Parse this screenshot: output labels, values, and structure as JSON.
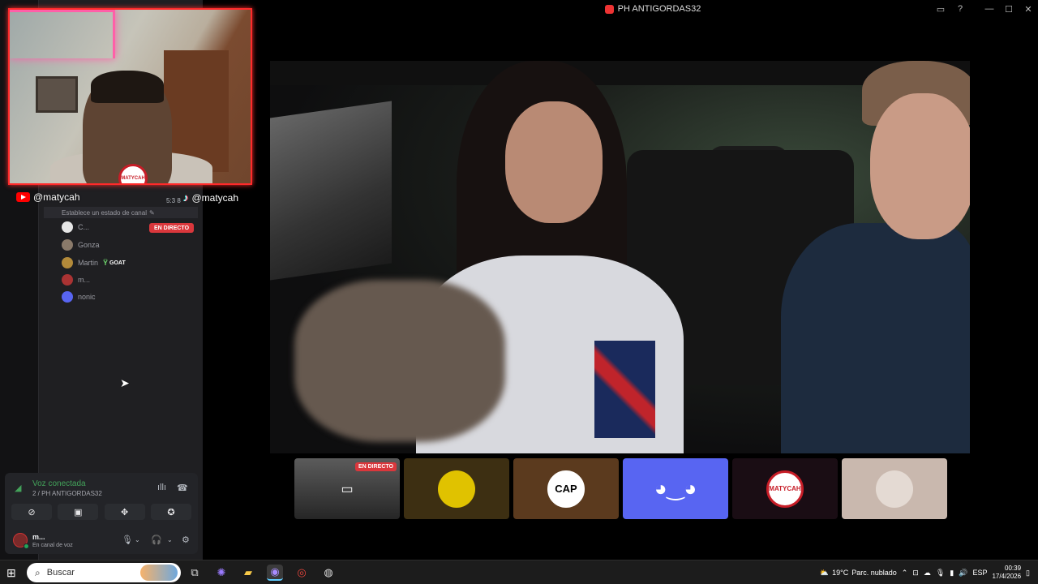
{
  "window": {
    "title": "PH ANTIGORDAS32"
  },
  "overlay": {
    "youtube_handle": "@matycah",
    "tiktok_handle": "@matycah",
    "logo_text": "MATYCAH",
    "clock_fragment": "5:3 8"
  },
  "sidebar": {
    "status_hint": "Establece un estado de canal",
    "members": [
      {
        "name": "C...",
        "live_badge": "EN DIRECTO",
        "avatar_color": "#e6e6e6"
      },
      {
        "name": "Gonza",
        "avatar_color": "#8a7a6a"
      },
      {
        "name": "Martin",
        "tag": "GOAT",
        "avatar_color": "#b38a3a"
      },
      {
        "name": "m...",
        "avatar_color": "#a33"
      },
      {
        "name": "nonic",
        "avatar_color": "#5865f2"
      }
    ]
  },
  "voice": {
    "status": "Voz conectada",
    "channel": "2 / PH ANTIGORDAS32",
    "user_name": "m...",
    "user_sub": "En canal de voz"
  },
  "thumbnails": [
    {
      "kind": "screen",
      "live_badge": "EN DIRECTO",
      "bg": "#333"
    },
    {
      "kind": "avatar",
      "bg": "#3d2f12"
    },
    {
      "kind": "cap",
      "label": "CAP",
      "bg": "#5b3a1e"
    },
    {
      "kind": "discord",
      "bg": "#5865f2"
    },
    {
      "kind": "logo",
      "label": "MATYCAH",
      "bg": "#1a0d14"
    },
    {
      "kind": "photo",
      "bg": "#c9b8ae"
    }
  ],
  "taskbar": {
    "search_placeholder": "Buscar",
    "weather_temp": "19°C",
    "weather_desc": "Parc. nublado",
    "language": "ESP",
    "time": "00:39",
    "date": "17/4/2026"
  },
  "colors": {
    "accent_red": "#ff2a2a",
    "discord_blurple": "#5865f2",
    "voice_green": "#43a25a",
    "live_red": "#da373c"
  }
}
